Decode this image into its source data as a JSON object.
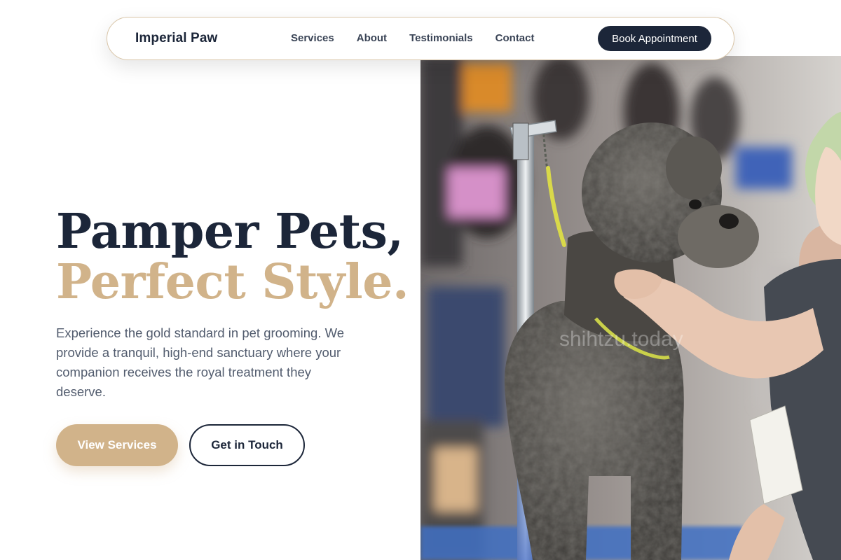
{
  "nav": {
    "brand": "Imperial Paw",
    "links": [
      "Services",
      "About",
      "Testimonials",
      "Contact"
    ],
    "cta": "Book Appointment"
  },
  "hero": {
    "headline_line1": "Pamper Pets,",
    "headline_line2": "Perfect Style.",
    "lead": "Experience the gold standard in pet grooming. We provide a tranquil, high-end sanctuary where your companion receives the royal treatment they deserve.",
    "primary_cta": "View Services",
    "secondary_cta": "Get in Touch",
    "image_watermark": "shihtzu.today"
  },
  "colors": {
    "navy": "#1c2639",
    "gold": "#d1b38a",
    "body_text": "#525c6e"
  }
}
